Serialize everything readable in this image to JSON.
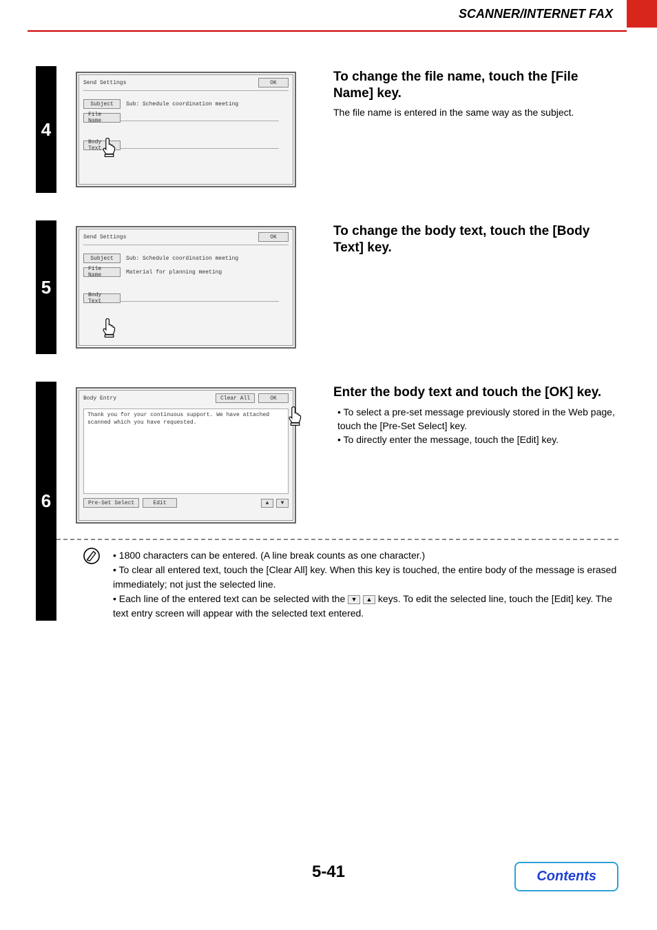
{
  "header": {
    "title": "SCANNER/INTERNET FAX"
  },
  "steps": {
    "s4": {
      "num": "4",
      "panel_title": "Send Settings",
      "ok": "OK",
      "subject_btn": "Subject",
      "subject_val": "Sub: Schedule coordination meeting",
      "filename_btn": "File Name",
      "bodytext_btn": "Body Text",
      "heading": "To change the file name, touch the [File Name] key.",
      "body": "The file name is entered in the same way as the subject."
    },
    "s5": {
      "num": "5",
      "panel_title": "Send Settings",
      "ok": "OK",
      "subject_btn": "Subject",
      "subject_val": "Sub: Schedule coordination meeting",
      "filename_btn": "File Name",
      "filename_val": "Material for planning meeting",
      "bodytext_btn": "Body Text",
      "heading": "To change the body text, touch the [Body Text] key."
    },
    "s6": {
      "num": "6",
      "panel_title": "Body Entry",
      "clear_all": "Clear All",
      "ok": "OK",
      "body_text": "Thank you for your continuous support. We have attached scanned which you have requested.",
      "preset_btn": "Pre-Set Select",
      "edit_btn": "Edit",
      "heading": "Enter the body text and touch the [OK] key.",
      "bullets": [
        "To select a pre-set message previously stored in the Web page, touch the [Pre-Set Select] key.",
        "To directly enter the message, touch the [Edit] key."
      ],
      "notes": {
        "n1": "1800 characters can be entered. (A line break counts as one character.)",
        "n2": "To clear all entered text, touch the [Clear All] key. When this key is touched, the entire body of the message is erased immediately; not just the selected line.",
        "n3a": "Each line of the entered text can be selected with the ",
        "n3b": " keys. To edit the selected line, touch the [Edit] key. The text entry screen will appear with the selected text entered."
      }
    }
  },
  "footer": {
    "page_num": "5-41",
    "contents": "Contents"
  }
}
